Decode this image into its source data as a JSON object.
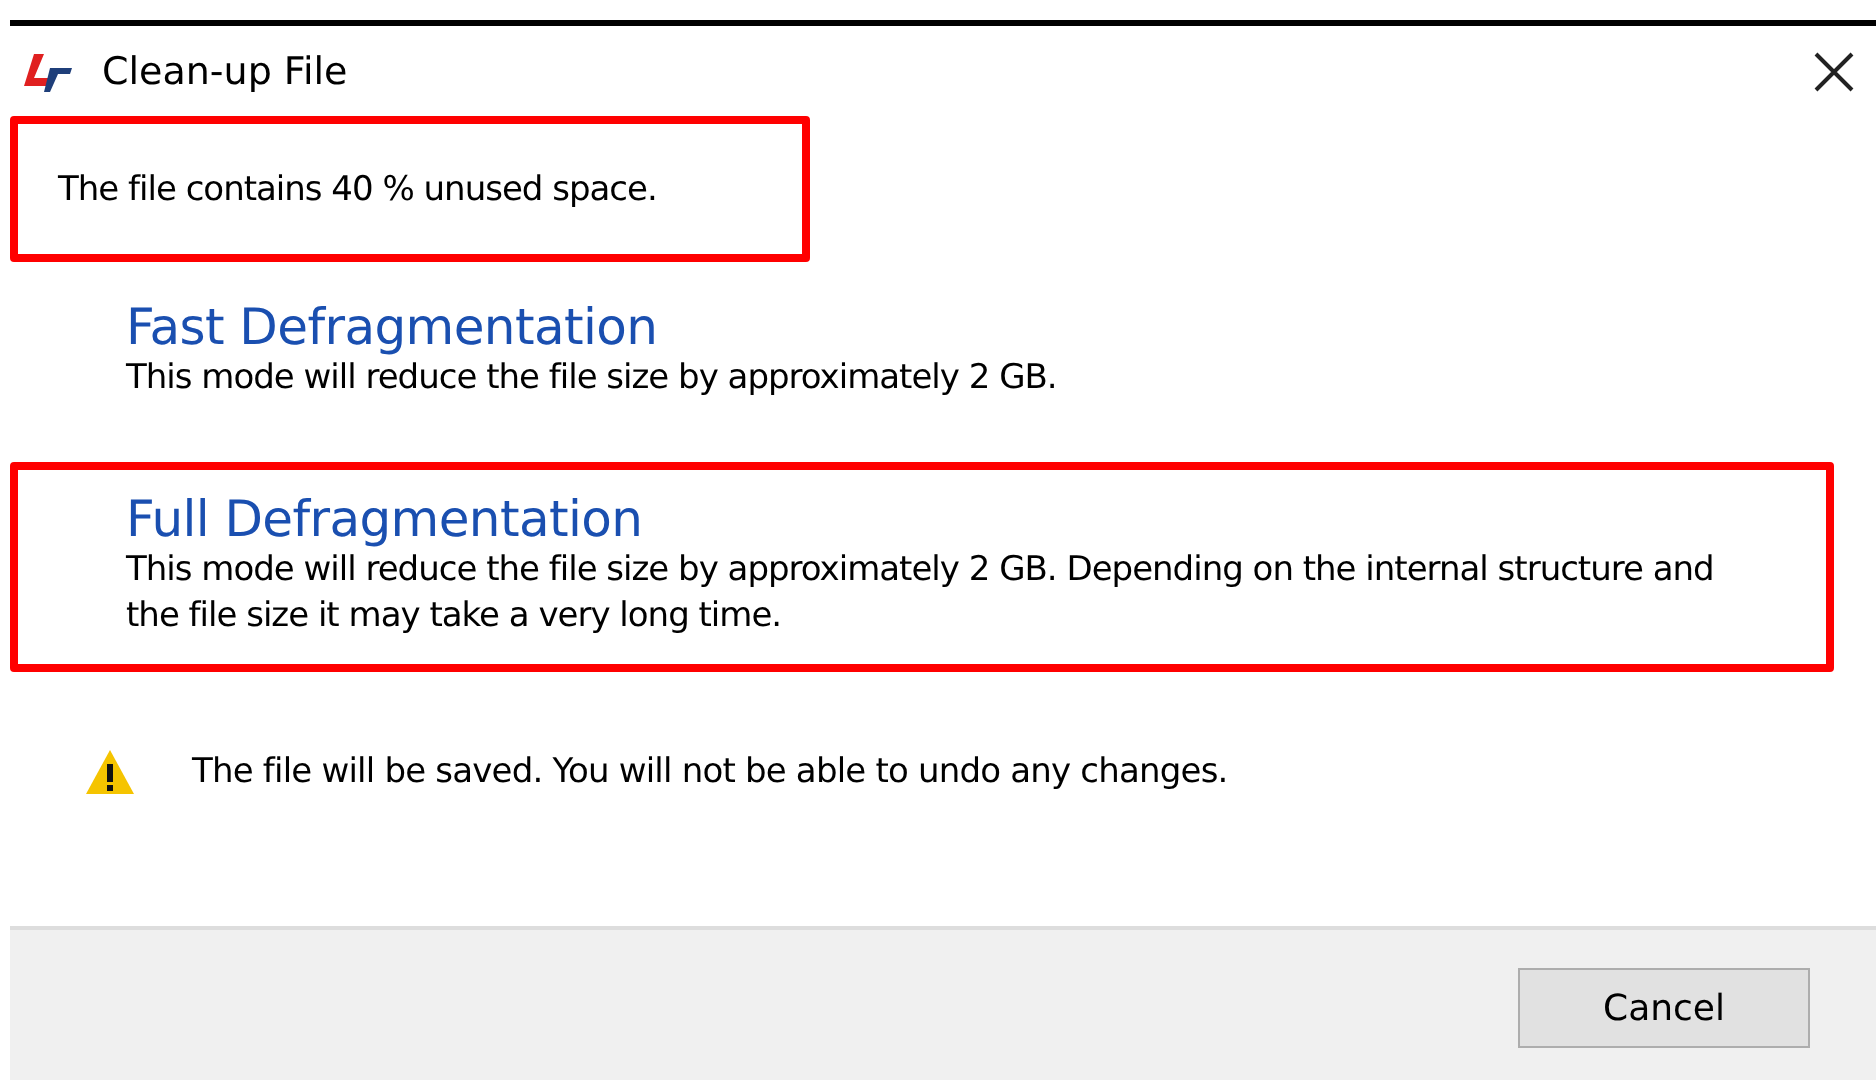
{
  "window": {
    "title": "Clean-up File"
  },
  "message": {
    "text": "The file contains 40 % unused space.",
    "highlighted": true
  },
  "modes": [
    {
      "title": "Fast Defragmentation",
      "description": "This mode will reduce the file size by approximately 2 GB.",
      "highlighted": false
    },
    {
      "title": "Full Defragmentation",
      "description": "This mode will reduce the file size by approximately 2 GB. Depending on the internal structure and the file size it may take a very long time.",
      "highlighted": true
    }
  ],
  "warning": "The file will be saved. You will not be able to undo any changes.",
  "buttons": [
    "Cancel"
  ]
}
